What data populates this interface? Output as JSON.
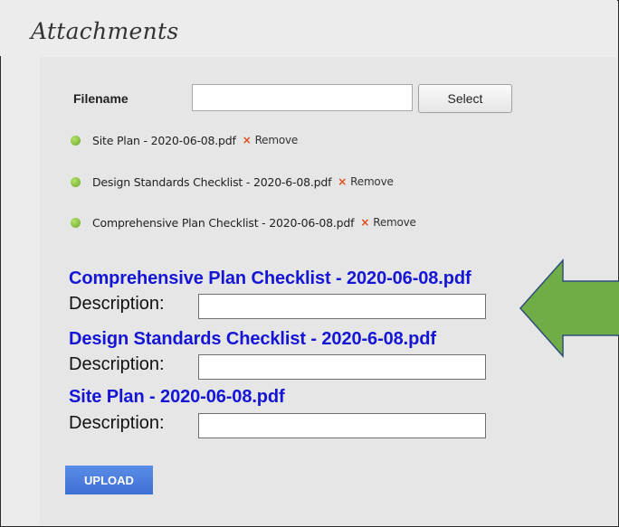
{
  "section_title": "Attachments",
  "file_picker": {
    "label": "Filename",
    "value": "",
    "select_label": "Select"
  },
  "attached_files": [
    {
      "name": "Site Plan - 2020-06-08.pdf",
      "remove_icon": "×",
      "remove_label": "Remove"
    },
    {
      "name": "Design Standards Checklist - 2020-6-08.pdf",
      "remove_icon": "×",
      "remove_label": "Remove"
    },
    {
      "name": "Comprehensive Plan Checklist - 2020-06-08.pdf",
      "remove_icon": "×",
      "remove_label": "Remove"
    }
  ],
  "descriptions": [
    {
      "filename": "Comprehensive Plan Checklist - 2020-06-08.pdf",
      "label": "Description:",
      "value": ""
    },
    {
      "filename": "Design Standards Checklist - 2020-6-08.pdf",
      "label": "Description:",
      "value": ""
    },
    {
      "filename": "Site Plan - 2020-06-08.pdf",
      "label": "Description:",
      "value": ""
    }
  ],
  "upload_label": "UPLOAD",
  "colors": {
    "accent_blue": "#1515d6",
    "button_blue": "#3f6fd4",
    "arrow_green": "#70ad47",
    "arrow_outline": "#2e4e7a",
    "status_dot": "#7cbf32",
    "remove_x": "#e14b13"
  },
  "icons": {
    "status": "green-dot-icon",
    "remove": "remove-x-icon",
    "annotation": "arrow-left-icon"
  }
}
